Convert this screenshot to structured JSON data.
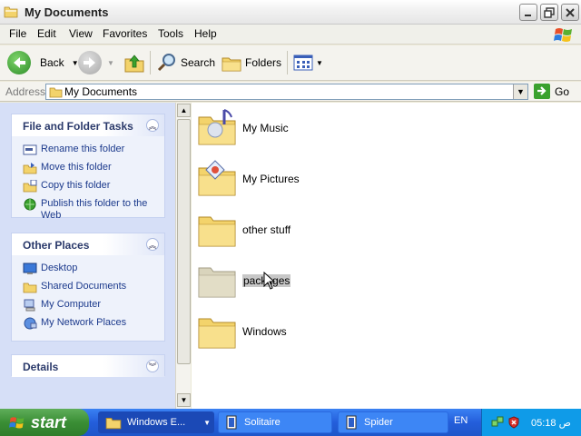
{
  "window": {
    "title": "My Documents"
  },
  "menu": [
    "File",
    "Edit",
    "View",
    "Favorites",
    "Tools",
    "Help"
  ],
  "toolbar": {
    "back": "Back",
    "search": "Search",
    "folders": "Folders"
  },
  "address": {
    "label": "Address",
    "value": "My Documents",
    "go": "Go"
  },
  "panels": {
    "file_tasks": {
      "title": "File and Folder Tasks",
      "items": [
        "Rename this folder",
        "Move this folder",
        "Copy this folder",
        "Publish this folder to the Web"
      ]
    },
    "other_places": {
      "title": "Other Places",
      "items": [
        "Desktop",
        "Shared Documents",
        "My Computer",
        "My Network Places"
      ]
    },
    "details": {
      "title": "Details"
    }
  },
  "files": [
    "My Music",
    "My Pictures",
    "other stuff",
    "packages",
    "Windows"
  ],
  "taskbar": {
    "start": "start",
    "buttons": [
      "Windows E...",
      "Solitaire",
      "Spider"
    ],
    "lang": "EN",
    "clock": "05:18 ص"
  },
  "colors": {
    "taskbar": "#245edb",
    "start": "#3a8e35",
    "panel": "#d6dff7",
    "link": "#1c3a8c"
  }
}
